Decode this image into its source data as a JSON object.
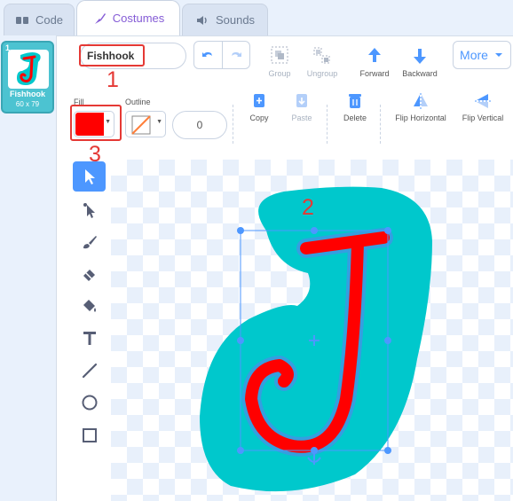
{
  "tabs": [
    {
      "label": "Code",
      "icon": "code-icon"
    },
    {
      "label": "Costumes",
      "icon": "brush-icon"
    },
    {
      "label": "Sounds",
      "icon": "speaker-icon"
    }
  ],
  "costume_list": {
    "items": [
      {
        "number": "1",
        "name": "Fishhook",
        "size": "60 x 79"
      }
    ]
  },
  "editor": {
    "costume_name": "Fishhook",
    "toolbar": {
      "group": "Group",
      "ungroup": "Ungroup",
      "forward": "Forward",
      "backward": "Backward",
      "more": "More",
      "copy": "Copy",
      "paste": "Paste",
      "delete": "Delete",
      "flip_horizontal": "Flip Horizontal",
      "flip_vertical": "Flip Vertical"
    },
    "fill": {
      "label": "Fill",
      "color": "#ff0000"
    },
    "outline": {
      "label": "Outline",
      "width": "0"
    }
  },
  "annotations": [
    "1",
    "2",
    "3"
  ],
  "colors": {
    "accent": "#855cd6",
    "highlight": "#e53935",
    "selection": "#4d97ff",
    "glyph_fill": "#ff0000",
    "backdrop": "#00c8cc"
  }
}
